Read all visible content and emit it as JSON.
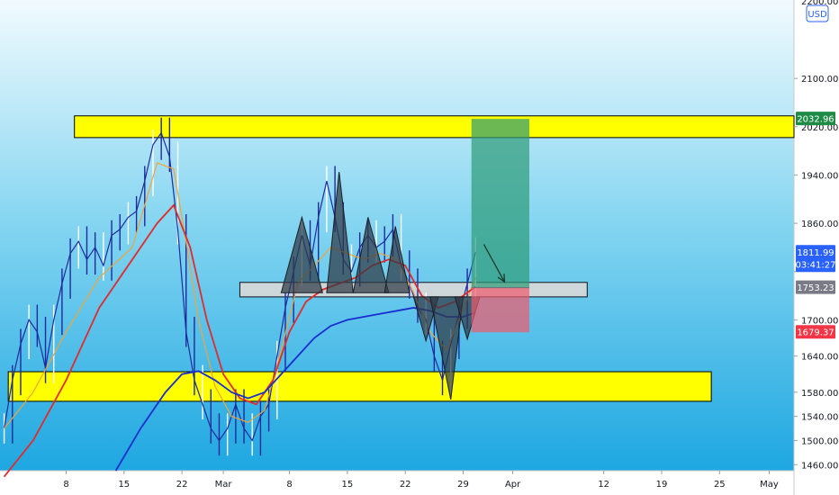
{
  "chart_data": {
    "type": "candlestick",
    "currency": "USD",
    "price_axis": {
      "ylim": [
        1450,
        2230
      ],
      "ticks": [
        2100,
        2020,
        1940,
        1860,
        1780,
        1700,
        1640,
        1580,
        1540,
        1500,
        1460
      ],
      "tick_labels": [
        "2100.00",
        "2020.00",
        "1940.00",
        "1860.00",
        "",
        "1700.00",
        "1640.00",
        "1580.00",
        "1540.00",
        "1500.00",
        "1460.00"
      ],
      "top_partial_label": "2200.00"
    },
    "time_axis": {
      "ticks": [
        8,
        15,
        22,
        27,
        35,
        42,
        49,
        56,
        62,
        73,
        80,
        87,
        93
      ],
      "tick_labels": [
        "8",
        "15",
        "22",
        "Mar",
        "8",
        "15",
        "22",
        "29",
        "Apr",
        "12",
        "19",
        "25",
        "May"
      ],
      "xlim": [
        0,
        96
      ]
    },
    "price_badges": [
      {
        "value": 2032.96,
        "label": "2032.96",
        "color": "#1e8c45"
      },
      {
        "value": 1811.99,
        "label": "1811.99",
        "sublabel": "03:41:27",
        "color": "#2962ff"
      },
      {
        "value": 1753.23,
        "label": "1753.23",
        "color": "#787b86"
      },
      {
        "value": 1679.37,
        "label": "1679.37",
        "color": "#f23645"
      }
    ],
    "zones": [
      {
        "kind": "resistance",
        "x": [
          9,
          96
        ],
        "y": [
          2002,
          2038
        ],
        "color": "#ffff00"
      },
      {
        "kind": "neckline",
        "x": [
          29,
          71
        ],
        "y": [
          1738,
          1762
        ],
        "color": "#d9d9d9"
      },
      {
        "kind": "support",
        "x": [
          1,
          86
        ],
        "y": [
          1565,
          1614
        ],
        "color": "#ffff00"
      }
    ],
    "position": {
      "entry": 1753.23,
      "target": 2032.96,
      "stop": 1679.37,
      "x": [
        57,
        64
      ],
      "profit_color": "#2e9b78",
      "loss_color": "#f05a6b"
    },
    "pattern_triangles": [
      {
        "points": [
          [
            34,
            1745
          ],
          [
            36.5,
            1870
          ],
          [
            39,
            1745
          ]
        ]
      },
      {
        "points": [
          [
            39.5,
            1745
          ],
          [
            41,
            1945
          ],
          [
            42.7,
            1745
          ]
        ]
      },
      {
        "points": [
          [
            42.7,
            1745
          ],
          [
            44.5,
            1870
          ],
          [
            47,
            1745
          ]
        ]
      },
      {
        "points": [
          [
            46.5,
            1745
          ],
          [
            47.8,
            1855
          ],
          [
            49.5,
            1745
          ]
        ]
      },
      {
        "points": [
          [
            50,
            1738
          ],
          [
            51.5,
            1665
          ],
          [
            53,
            1738
          ]
        ]
      },
      {
        "points": [
          [
            52,
            1738
          ],
          [
            54.5,
            1568
          ],
          [
            56,
            1738
          ]
        ]
      },
      {
        "points": [
          [
            55,
            1738
          ],
          [
            56.5,
            1668
          ],
          [
            58,
            1738
          ]
        ]
      }
    ],
    "annotation_arrow": {
      "from": [
        58.5,
        1825
      ],
      "to": [
        61,
        1763
      ]
    },
    "series": [
      {
        "kind": "ohlc-close",
        "color": "#1f2a9e",
        "x": [
          0.5,
          1.5,
          2.5,
          3.5,
          4.5,
          5.5,
          6.5,
          7.5,
          8.5,
          9.5,
          10.5,
          11.5,
          12.5,
          13.5,
          14.5,
          15.5,
          16.5,
          17.5,
          18.5,
          19.5,
          20.5,
          21.5,
          22.5,
          23.5,
          24.5,
          25.5,
          26.5,
          27.5,
          28.5,
          29.5,
          30.5,
          31.5,
          32.5,
          33.5,
          34.5,
          35.5,
          36.5,
          37.5,
          38.5,
          39.5,
          40.5,
          41.5,
          42.5,
          43.5,
          44.5,
          45.5,
          46.5,
          47.5,
          48.5,
          49.5,
          50.5,
          51.5,
          52.5,
          53.5,
          54.5,
          55.5,
          56.5,
          57.5
        ],
        "close": [
          1520,
          1600,
          1660,
          1700,
          1680,
          1620,
          1700,
          1760,
          1810,
          1830,
          1800,
          1820,
          1790,
          1840,
          1850,
          1870,
          1880,
          1930,
          1990,
          2010,
          1970,
          1850,
          1680,
          1600,
          1560,
          1520,
          1500,
          1520,
          1560,
          1520,
          1500,
          1540,
          1560,
          1640,
          1720,
          1780,
          1840,
          1790,
          1870,
          1930,
          1870,
          1800,
          1780,
          1820,
          1840,
          1820,
          1830,
          1850,
          1790,
          1760,
          1720,
          1700,
          1640,
          1600,
          1660,
          1710,
          1760,
          1812
        ]
      },
      {
        "kind": "ma-fast",
        "color": "#f2a33a",
        "x": [
          0.5,
          4,
          8,
          12,
          16,
          19,
          21,
          22.5,
          24,
          26,
          28,
          30,
          32,
          34,
          36,
          38,
          40,
          42,
          44,
          46,
          48,
          50,
          52,
          54,
          55.5,
          57.5
        ],
        "y": [
          1520,
          1580,
          1680,
          1770,
          1820,
          1960,
          1950,
          1830,
          1700,
          1590,
          1540,
          1530,
          1550,
          1650,
          1760,
          1790,
          1820,
          1810,
          1800,
          1810,
          1800,
          1745,
          1680,
          1650,
          1700,
          1770
        ]
      },
      {
        "kind": "ma-mid",
        "color": "#e02c2c",
        "x": [
          0.5,
          4,
          8,
          12,
          16,
          19,
          21,
          23,
          25,
          27,
          29,
          31,
          33,
          35,
          37,
          39,
          41,
          43,
          45,
          47,
          49,
          51,
          53,
          55,
          57.5
        ],
        "y": [
          1440,
          1500,
          1600,
          1720,
          1800,
          1860,
          1890,
          1820,
          1700,
          1610,
          1570,
          1560,
          1600,
          1680,
          1730,
          1750,
          1760,
          1770,
          1790,
          1800,
          1790,
          1740,
          1720,
          1730,
          1755
        ]
      },
      {
        "kind": "ma-slow",
        "color": "#1a2ecf",
        "x": [
          14,
          17,
          20,
          22,
          24,
          26,
          28,
          30,
          32,
          34,
          36,
          38,
          40,
          42,
          44,
          46,
          48,
          50,
          52,
          54,
          56,
          57.5
        ],
        "y": [
          1450,
          1520,
          1580,
          1610,
          1615,
          1600,
          1580,
          1570,
          1580,
          1610,
          1640,
          1670,
          1690,
          1700,
          1705,
          1710,
          1715,
          1720,
          1715,
          1705,
          1705,
          1712
        ]
      }
    ]
  }
}
